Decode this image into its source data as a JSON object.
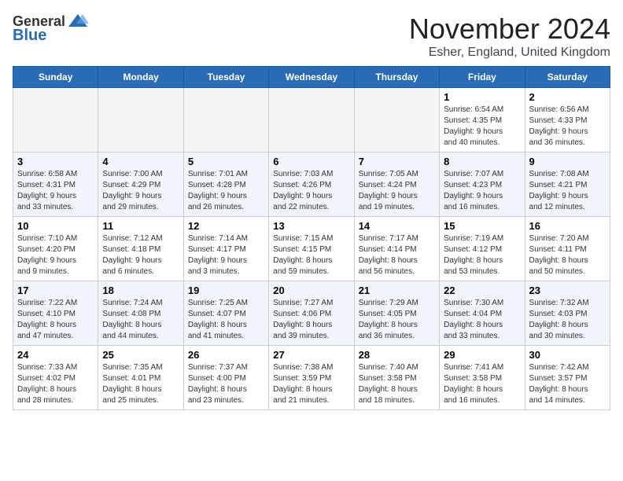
{
  "header": {
    "logo_general": "General",
    "logo_blue": "Blue",
    "month_title": "November 2024",
    "location": "Esher, England, United Kingdom"
  },
  "days_of_week": [
    "Sunday",
    "Monday",
    "Tuesday",
    "Wednesday",
    "Thursday",
    "Friday",
    "Saturday"
  ],
  "weeks": [
    [
      {
        "day": "",
        "info": "",
        "empty": true
      },
      {
        "day": "",
        "info": "",
        "empty": true
      },
      {
        "day": "",
        "info": "",
        "empty": true
      },
      {
        "day": "",
        "info": "",
        "empty": true
      },
      {
        "day": "",
        "info": "",
        "empty": true
      },
      {
        "day": "1",
        "info": "Sunrise: 6:54 AM\nSunset: 4:35 PM\nDaylight: 9 hours\nand 40 minutes."
      },
      {
        "day": "2",
        "info": "Sunrise: 6:56 AM\nSunset: 4:33 PM\nDaylight: 9 hours\nand 36 minutes."
      }
    ],
    [
      {
        "day": "3",
        "info": "Sunrise: 6:58 AM\nSunset: 4:31 PM\nDaylight: 9 hours\nand 33 minutes."
      },
      {
        "day": "4",
        "info": "Sunrise: 7:00 AM\nSunset: 4:29 PM\nDaylight: 9 hours\nand 29 minutes."
      },
      {
        "day": "5",
        "info": "Sunrise: 7:01 AM\nSunset: 4:28 PM\nDaylight: 9 hours\nand 26 minutes."
      },
      {
        "day": "6",
        "info": "Sunrise: 7:03 AM\nSunset: 4:26 PM\nDaylight: 9 hours\nand 22 minutes."
      },
      {
        "day": "7",
        "info": "Sunrise: 7:05 AM\nSunset: 4:24 PM\nDaylight: 9 hours\nand 19 minutes."
      },
      {
        "day": "8",
        "info": "Sunrise: 7:07 AM\nSunset: 4:23 PM\nDaylight: 9 hours\nand 16 minutes."
      },
      {
        "day": "9",
        "info": "Sunrise: 7:08 AM\nSunset: 4:21 PM\nDaylight: 9 hours\nand 12 minutes."
      }
    ],
    [
      {
        "day": "10",
        "info": "Sunrise: 7:10 AM\nSunset: 4:20 PM\nDaylight: 9 hours\nand 9 minutes."
      },
      {
        "day": "11",
        "info": "Sunrise: 7:12 AM\nSunset: 4:18 PM\nDaylight: 9 hours\nand 6 minutes."
      },
      {
        "day": "12",
        "info": "Sunrise: 7:14 AM\nSunset: 4:17 PM\nDaylight: 9 hours\nand 3 minutes."
      },
      {
        "day": "13",
        "info": "Sunrise: 7:15 AM\nSunset: 4:15 PM\nDaylight: 8 hours\nand 59 minutes."
      },
      {
        "day": "14",
        "info": "Sunrise: 7:17 AM\nSunset: 4:14 PM\nDaylight: 8 hours\nand 56 minutes."
      },
      {
        "day": "15",
        "info": "Sunrise: 7:19 AM\nSunset: 4:12 PM\nDaylight: 8 hours\nand 53 minutes."
      },
      {
        "day": "16",
        "info": "Sunrise: 7:20 AM\nSunset: 4:11 PM\nDaylight: 8 hours\nand 50 minutes."
      }
    ],
    [
      {
        "day": "17",
        "info": "Sunrise: 7:22 AM\nSunset: 4:10 PM\nDaylight: 8 hours\nand 47 minutes."
      },
      {
        "day": "18",
        "info": "Sunrise: 7:24 AM\nSunset: 4:08 PM\nDaylight: 8 hours\nand 44 minutes."
      },
      {
        "day": "19",
        "info": "Sunrise: 7:25 AM\nSunset: 4:07 PM\nDaylight: 8 hours\nand 41 minutes."
      },
      {
        "day": "20",
        "info": "Sunrise: 7:27 AM\nSunset: 4:06 PM\nDaylight: 8 hours\nand 39 minutes."
      },
      {
        "day": "21",
        "info": "Sunrise: 7:29 AM\nSunset: 4:05 PM\nDaylight: 8 hours\nand 36 minutes."
      },
      {
        "day": "22",
        "info": "Sunrise: 7:30 AM\nSunset: 4:04 PM\nDaylight: 8 hours\nand 33 minutes."
      },
      {
        "day": "23",
        "info": "Sunrise: 7:32 AM\nSunset: 4:03 PM\nDaylight: 8 hours\nand 30 minutes."
      }
    ],
    [
      {
        "day": "24",
        "info": "Sunrise: 7:33 AM\nSunset: 4:02 PM\nDaylight: 8 hours\nand 28 minutes."
      },
      {
        "day": "25",
        "info": "Sunrise: 7:35 AM\nSunset: 4:01 PM\nDaylight: 8 hours\nand 25 minutes."
      },
      {
        "day": "26",
        "info": "Sunrise: 7:37 AM\nSunset: 4:00 PM\nDaylight: 8 hours\nand 23 minutes."
      },
      {
        "day": "27",
        "info": "Sunrise: 7:38 AM\nSunset: 3:59 PM\nDaylight: 8 hours\nand 21 minutes."
      },
      {
        "day": "28",
        "info": "Sunrise: 7:40 AM\nSunset: 3:58 PM\nDaylight: 8 hours\nand 18 minutes."
      },
      {
        "day": "29",
        "info": "Sunrise: 7:41 AM\nSunset: 3:58 PM\nDaylight: 8 hours\nand 16 minutes."
      },
      {
        "day": "30",
        "info": "Sunrise: 7:42 AM\nSunset: 3:57 PM\nDaylight: 8 hours\nand 14 minutes."
      }
    ]
  ]
}
